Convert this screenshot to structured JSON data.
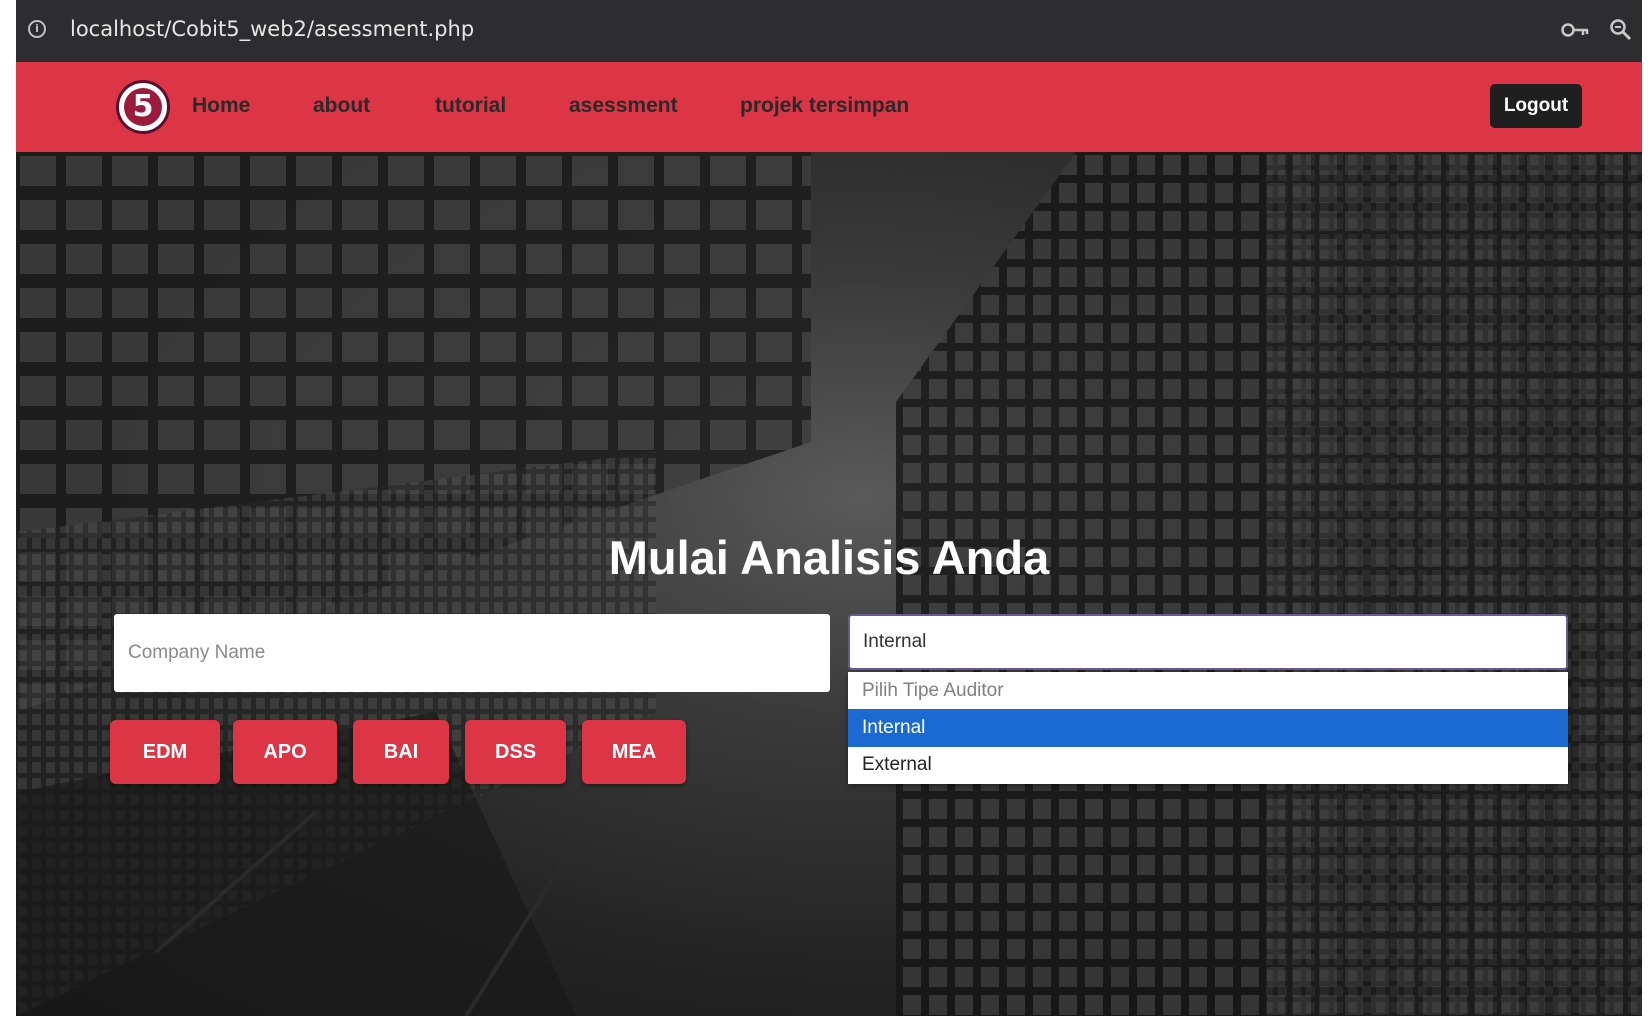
{
  "browser": {
    "url": "localhost/Cobit5_web2/asessment.php",
    "icons": [
      "info-icon",
      "key-icon",
      "zoom-icon"
    ]
  },
  "navbar": {
    "logo_text": "5",
    "links": [
      "Home",
      "about",
      "tutorial",
      "asessment",
      "projek tersimpan"
    ],
    "logout_label": "Logout",
    "colors": {
      "background": "#dc3545",
      "logout_bg": "#1f1f1f"
    }
  },
  "hero": {
    "title": "Mulai Analisis Anda",
    "company_input": {
      "placeholder": "Company Name",
      "value": ""
    },
    "buttons": [
      "EDM",
      "APO",
      "BAI",
      "DSS",
      "MEA"
    ],
    "auditor_select": {
      "selected": "Internal",
      "options": [
        "Pilih Tipe Auditor",
        "Internal",
        "External"
      ],
      "highlighted": "Internal"
    },
    "colors": {
      "button": "#dc3545",
      "option_highlight": "#1a6ad2"
    }
  }
}
